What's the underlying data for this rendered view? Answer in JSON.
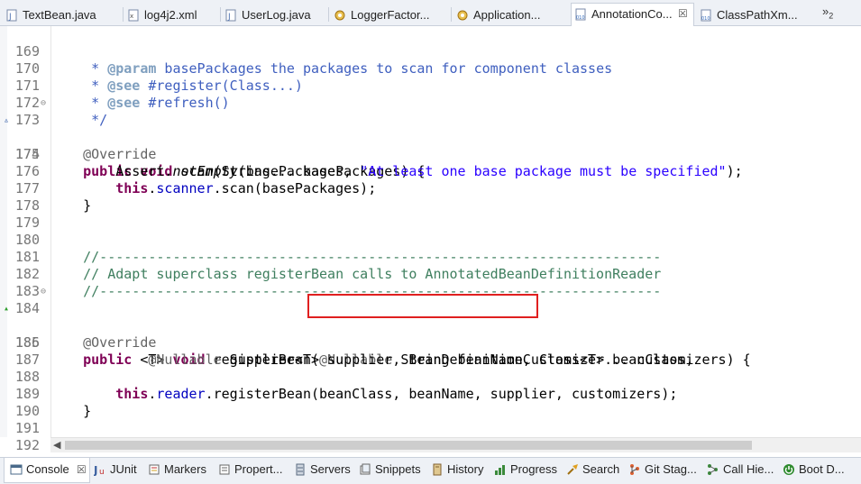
{
  "tabs": [
    {
      "label": "TextBean.java",
      "icon": "java-file-icon"
    },
    {
      "label": "log4j2.xml",
      "icon": "xml-file-icon"
    },
    {
      "label": "UserLog.java",
      "icon": "java-file-icon"
    },
    {
      "label": "LoggerFactor...",
      "icon": "class-file-icon"
    },
    {
      "label": "Application...",
      "icon": "class-file-icon"
    },
    {
      "label": "AnnotationCo...",
      "icon": "binary-class-icon",
      "active": true,
      "close": "☒"
    },
    {
      "label": "ClassPathXm...",
      "icon": "binary-class-icon"
    }
  ],
  "tab_overflow": {
    "symbol": "»",
    "count": "2"
  },
  "editor": {
    "lines": [
      {
        "n": "169"
      },
      {
        "n": "170"
      },
      {
        "n": "171"
      },
      {
        "n": "172"
      },
      {
        "n": "173",
        "fold": "⊖"
      },
      {
        "n": "174",
        "override": "▵"
      },
      {
        "n": "175"
      },
      {
        "n": "176"
      },
      {
        "n": "177"
      },
      {
        "n": "178"
      },
      {
        "n": "179"
      },
      {
        "n": "180"
      },
      {
        "n": "181"
      },
      {
        "n": "182"
      },
      {
        "n": "183"
      },
      {
        "n": "184",
        "fold": "⊖"
      },
      {
        "n": "185",
        "override": "▴"
      },
      {
        "n": "186"
      },
      {
        "n": "187"
      },
      {
        "n": "188"
      },
      {
        "n": "189"
      },
      {
        "n": "190"
      },
      {
        "n": "191"
      },
      {
        "n": "192"
      }
    ],
    "code": {
      "l169_star": "     * ",
      "l169_tag": "@param",
      "l169_txt": " basePackages the packages to scan for component classes",
      "l170_star": "     * ",
      "l170_tag": "@see",
      "l170_txt": " #register(Class...)",
      "l171_star": "     * ",
      "l171_tag": "@see",
      "l171_txt": " #refresh()",
      "l172": "     */",
      "l173": "    @Override",
      "l174_kw1": "    public",
      "l174_kw2": " void",
      "l174_txt": " scan(String... basePackages) {",
      "l175_a": "        Assert.",
      "l175_m": "notEmpty",
      "l175_b": "(basePackages, ",
      "l175_s": "\"At least one base package must be specified\"",
      "l175_c": ");",
      "l176_kw": "        this",
      "l176_dot": ".",
      "l176_f": "scanner",
      "l176_txt": ".scan(basePackages);",
      "l177": "    }",
      "l180": "    //---------------------------------------------------------------------",
      "l181": "    // Adapt superclass registerBean calls to AnnotatedBeanDefinitionReader",
      "l182": "    //---------------------------------------------------------------------",
      "l184": "    @Override",
      "l185_kw1": "    public",
      "l185_g": " <T>",
      "l185_kw2": " void",
      "l185_a": " registerBean(",
      "l185_ann": "@Nullable",
      "l185_b": " String beanName, Class<T> beanClass,",
      "l186_ann": "            @Nullable",
      "l186_b": " Supplier<T> supplier, BeanDefinitionCustomizer... customizers) {",
      "l188_kw": "        this",
      "l188_dot": ".",
      "l188_f": "reader",
      "l188_txt": ".registerBean(beanClass, beanName, supplier, customizers);",
      "l189": "    }",
      "l191": "}"
    }
  },
  "hscroll": {
    "left_arrow": "◀"
  },
  "bottom_tabs": [
    {
      "label": "Console",
      "icon": "console-icon",
      "active": true,
      "close": "☒"
    },
    {
      "label": "JUnit",
      "icon": "junit-icon"
    },
    {
      "label": "Markers",
      "icon": "markers-icon"
    },
    {
      "label": "Propert...",
      "icon": "properties-icon"
    },
    {
      "label": "Servers",
      "icon": "servers-icon"
    },
    {
      "label": "Snippets",
      "icon": "snippets-icon"
    },
    {
      "label": "History",
      "icon": "history-icon"
    },
    {
      "label": "Progress",
      "icon": "progress-icon"
    },
    {
      "label": "Search",
      "icon": "search-icon"
    },
    {
      "label": "Git Stag...",
      "icon": "git-staging-icon"
    },
    {
      "label": "Call Hie...",
      "icon": "call-hierarchy-icon"
    },
    {
      "label": "Boot D...",
      "icon": "boot-dashboard-icon"
    }
  ],
  "colors": {
    "keyword": "#7f0055",
    "comment": "#3f5fbf",
    "string": "#2a00ff",
    "field": "#0000c0",
    "annotation": "#646464",
    "highlight_box": "#e02020"
  }
}
